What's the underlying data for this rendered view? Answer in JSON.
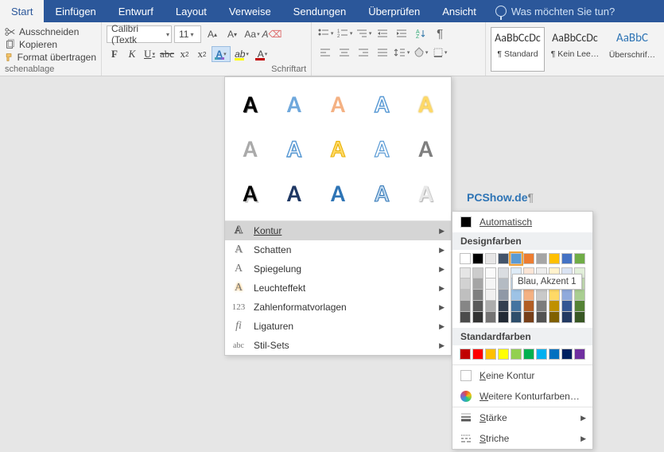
{
  "tabs": {
    "items": [
      "Start",
      "Einfügen",
      "Entwurf",
      "Layout",
      "Verweise",
      "Sendungen",
      "Überprüfen",
      "Ansicht"
    ],
    "active": 0,
    "tellme": "Was möchten Sie tun?"
  },
  "clipboard": {
    "cut": "Ausschneiden",
    "copy": "Kopieren",
    "painter": "Format übertragen",
    "label": "schenablage"
  },
  "font": {
    "name": "Calibri (Textk",
    "size": "11",
    "label": "Schriftart"
  },
  "styles": {
    "sample": "AaBbCcDc",
    "sampleBlue": "AaBbC",
    "s1": "¶ Standard",
    "s2": "¶ Kein Lee…",
    "s3": "Überschrif…"
  },
  "fx_menu": {
    "kontur": "Kontur",
    "schatten": "Schatten",
    "spiegelung": "Spiegelung",
    "leuchteffekt": "Leuchteffekt",
    "zahlen": "Zahlenformatvorlagen",
    "ligaturen": "Ligaturen",
    "stilsets": "Stil-Sets"
  },
  "color_fly": {
    "automatic": "Automatisch",
    "design_head": "Designfarben",
    "tooltip": "Blau, Akzent 1",
    "standard_head": "Standardfarben",
    "theme_colors": [
      "#ffffff",
      "#000000",
      "#e7e6e6",
      "#44546a",
      "#5b9bd5",
      "#ed7d31",
      "#a5a5a5",
      "#ffc000",
      "#4472c4",
      "#70ad47"
    ],
    "standard_colors": [
      "#c00000",
      "#ff0000",
      "#ffc000",
      "#ffff00",
      "#92d050",
      "#00b050",
      "#00b0f0",
      "#0070c0",
      "#002060",
      "#7030a0"
    ],
    "nokontur": "Keine Kontur",
    "more": "Weitere Konturfarben…",
    "staerke": "Stärke",
    "striche": "Striche"
  },
  "doc": {
    "text": "PCShow.de",
    "pilcrow": "¶"
  }
}
